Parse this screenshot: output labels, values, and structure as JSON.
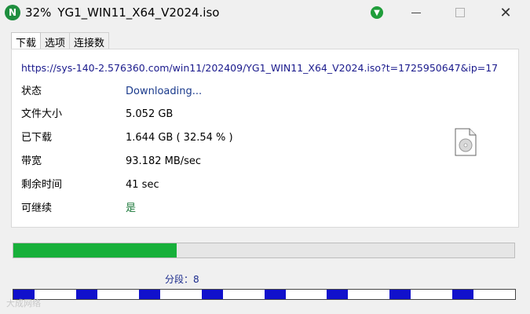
{
  "window": {
    "app_icon_letter": "N",
    "progress_text": "32%",
    "filename": "YG1_WIN11_X64_V2024.iso",
    "close_glyph": "✕"
  },
  "tabs": [
    {
      "label": "下载",
      "active": true
    },
    {
      "label": "选项",
      "active": false
    },
    {
      "label": "连接数",
      "active": false
    }
  ],
  "info": {
    "url": "https://sys-140-2.576360.com/win11/202409/YG1_WIN11_X64_V2024.iso?t=1725950647&ip=17",
    "rows": [
      {
        "label": "状态",
        "value": "Downloading..."
      },
      {
        "label": "文件大小",
        "value": "5.052 GB"
      },
      {
        "label": "已下载",
        "value": "1.644 GB ( 32.54 % )"
      },
      {
        "label": "带宽",
        "value": "93.182 MB/sec"
      },
      {
        "label": "剩余时间",
        "value": "41 sec"
      },
      {
        "label": "可继续",
        "value": "是"
      }
    ]
  },
  "progress": {
    "percent": 32.54,
    "fill_color": "#17b03a"
  },
  "segments": {
    "label": "分段：8",
    "count": 8,
    "done_fraction": 0.32,
    "color": "#1111cc"
  },
  "watermark": "大成网络"
}
